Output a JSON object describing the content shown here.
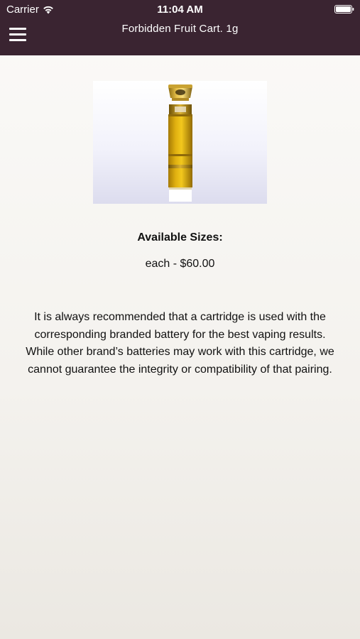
{
  "status_bar": {
    "carrier": "Carrier",
    "time": "11:04 AM"
  },
  "nav": {
    "title": "Forbidden Fruit Cart. 1g",
    "menu_icon": "hamburger-menu-icon"
  },
  "product": {
    "image_subject": "cartridge-image",
    "sizes_heading": "Available Sizes:",
    "sizes": [
      {
        "label": "each - $60.00"
      }
    ],
    "description": "It is always recommended that a cartridge is used with the corresponding branded battery for the best vaping results. While other brand’s batteries may work with this cartridge, we cannot guarantee the integrity or compatibility of that pairing."
  },
  "colors": {
    "header_bg": "#3a2431",
    "header_text": "#ffffff",
    "body_text": "#111111"
  }
}
